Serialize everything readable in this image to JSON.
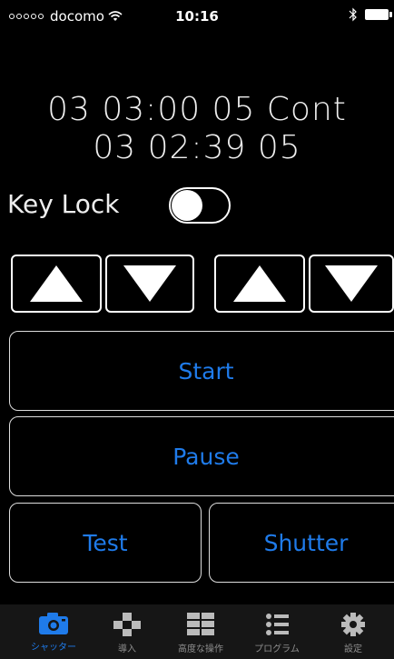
{
  "status_bar": {
    "carrier": "docomo",
    "time": "10:16"
  },
  "display": {
    "line1": "03 03:00 05 Cont",
    "line2": "03 02:39 05"
  },
  "key_lock": {
    "label": "Key Lock",
    "on": false
  },
  "arrows": [
    "up",
    "down",
    "up",
    "down"
  ],
  "buttons": {
    "start": "Start",
    "pause": "Pause",
    "test": "Test",
    "shutter": "Shutter"
  },
  "colors": {
    "accent": "#1f7bea",
    "background": "#000000",
    "tab_inactive": "#8e8e8e"
  },
  "tab_bar": {
    "tabs": [
      {
        "label": "シャッター",
        "icon": "camera-icon",
        "active": true
      },
      {
        "label": "導入",
        "icon": "dpad-icon",
        "active": false
      },
      {
        "label": "高度な操作",
        "icon": "grid-icon",
        "active": false
      },
      {
        "label": "プログラム",
        "icon": "list-icon",
        "active": false
      },
      {
        "label": "設定",
        "icon": "gear-icon",
        "active": false
      }
    ]
  }
}
